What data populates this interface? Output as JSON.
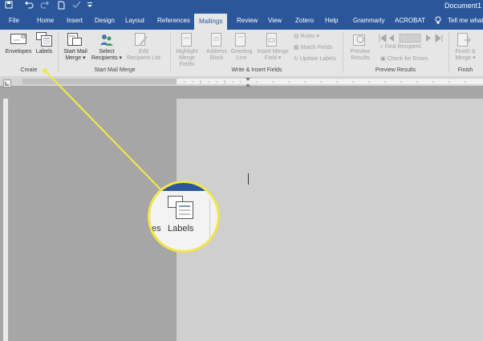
{
  "titlebar": {
    "doc_title": "Document1",
    "qat_icons": [
      "save-icon",
      "undo-icon",
      "redo-icon",
      "new-doc-icon",
      "check-icon",
      "customize-icon"
    ]
  },
  "tabs": [
    {
      "label": "File"
    },
    {
      "label": "Home"
    },
    {
      "label": "Insert"
    },
    {
      "label": "Design"
    },
    {
      "label": "Layout"
    },
    {
      "label": "References"
    },
    {
      "label": "Mailings",
      "active": true
    },
    {
      "label": "Review"
    },
    {
      "label": "View"
    },
    {
      "label": "Zotero"
    },
    {
      "label": "Help"
    },
    {
      "label": "Grammarly"
    },
    {
      "label": "ACROBAT"
    },
    {
      "label": "Tell me what"
    }
  ],
  "ribbon": {
    "create": {
      "group_label": "Create",
      "envelopes": "Envelopes",
      "labels": "Labels"
    },
    "start_mail_merge": {
      "group_label": "Start Mail Merge",
      "start_mail_merge_line1": "Start Mail",
      "start_mail_merge_line2": "Merge ▾",
      "select_recipients_line1": "Select",
      "select_recipients_line2": "Recipients ▾",
      "edit_recipient_line1": "Edit",
      "edit_recipient_line2": "Recipient List"
    },
    "write_insert": {
      "group_label": "Write & Insert Fields",
      "highlight_line1": "Highlight",
      "highlight_line2": "Merge Fields",
      "address_line1": "Address",
      "address_line2": "Block",
      "greeting_line1": "Greeting",
      "greeting_line2": "Line",
      "insert_merge_line1": "Insert Merge",
      "insert_merge_line2": "Field ▾",
      "rules": "Rules ▾",
      "match_fields": "Match Fields",
      "update_labels": "Update Labels"
    },
    "preview": {
      "group_label": "Preview Results",
      "preview_line1": "Preview",
      "preview_line2": "Results",
      "find_recipient": "Find Recipient",
      "check_errors": "Check for Errors"
    },
    "finish": {
      "group_label": "Finish",
      "finish_line1": "Finish &",
      "finish_line2": "Merge ▾"
    }
  },
  "magnifier": {
    "left_fragment": "es",
    "labels": "Labels"
  },
  "colors": {
    "ribbon_blue": "#2b579a",
    "highlight_yellow": "#f0e64a"
  }
}
